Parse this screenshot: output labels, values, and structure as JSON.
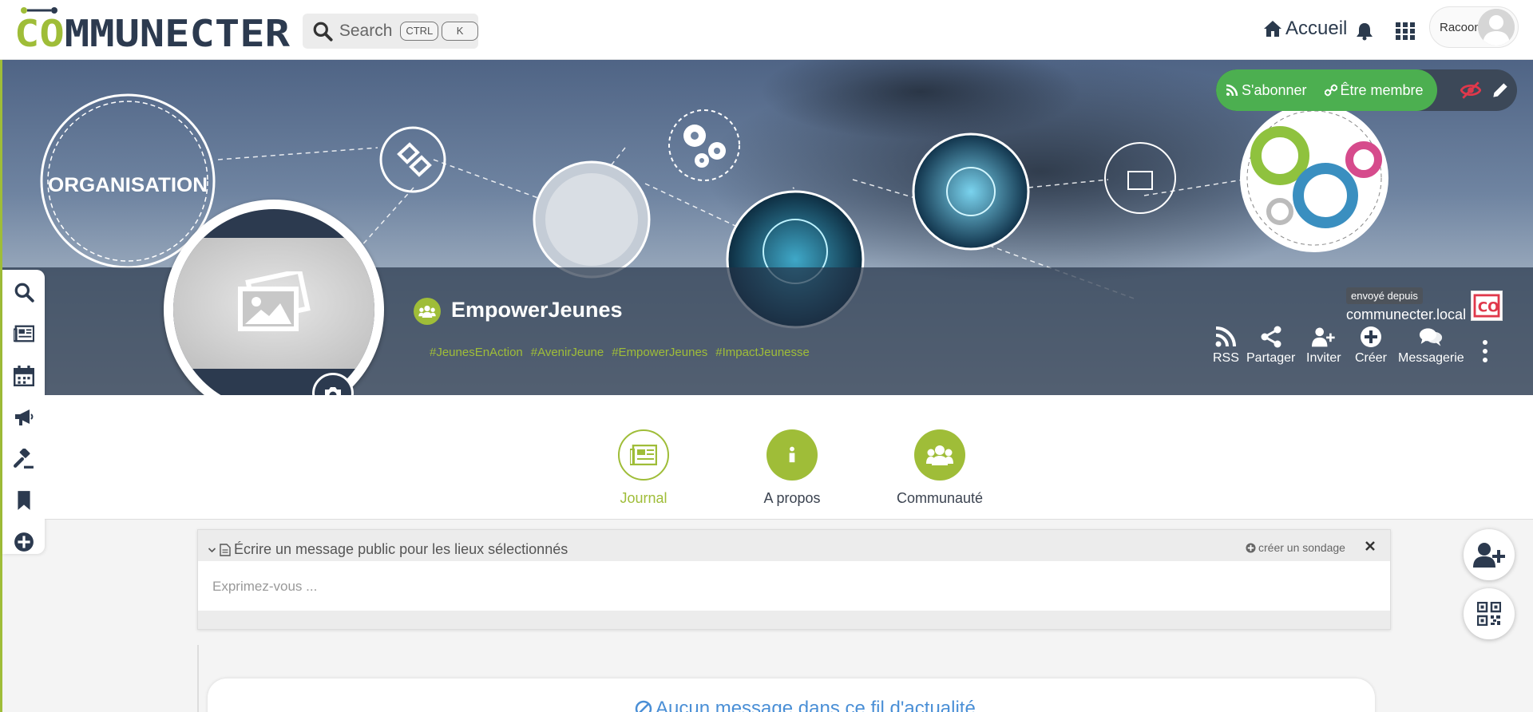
{
  "header": {
    "logo_text": "COMMUNECTER",
    "search": {
      "label": "Search",
      "kbd_ctrl": "CTRL",
      "kbd_k": "K"
    },
    "home_label": "Accueil",
    "user_name": "Racoon"
  },
  "banner": {
    "org_badge_text": "ORGANISATION",
    "follow_label": "S'abonner",
    "member_label": "Être membre",
    "sent_from_label": "envoyé depuis",
    "sent_from_host": "communecter.local",
    "co_logo_text": "CO"
  },
  "profile": {
    "name": "EmpowerJeunes",
    "tags": [
      "#JeunesEnAction",
      "#AvenirJeune",
      "#EmpowerJeunes",
      "#ImpactJeunesse"
    ]
  },
  "actions": [
    {
      "label": "RSS",
      "icon": "rss-icon"
    },
    {
      "label": "Partager",
      "icon": "share-icon"
    },
    {
      "label": "Inviter",
      "icon": "user-plus-icon"
    },
    {
      "label": "Créer",
      "icon": "plus-circle-icon"
    },
    {
      "label": "Messagerie",
      "icon": "comments-icon"
    }
  ],
  "tabs": [
    {
      "label": "Journal",
      "active": true
    },
    {
      "label": "A propos",
      "active": false
    },
    {
      "label": "Communauté",
      "active": false
    }
  ],
  "composer": {
    "header": "Écrire un message public pour les lieux sélectionnés",
    "poll_label": "créer un sondage",
    "placeholder": "Exprimez-vous ..."
  },
  "feed": {
    "empty_message": "Aucun message dans ce fil d'actualité"
  },
  "colors": {
    "accent_green": "#9fbd38",
    "follow_green": "#4caf50",
    "dark_navy": "#2c3a4f",
    "link_blue": "#4a8fd6",
    "alert_red": "#e0384b"
  },
  "sidebar_icons": [
    "search-icon",
    "newspaper-icon",
    "calendar-icon",
    "bullhorn-icon",
    "gavel-icon",
    "bookmark-icon",
    "plus-circle-icon"
  ]
}
